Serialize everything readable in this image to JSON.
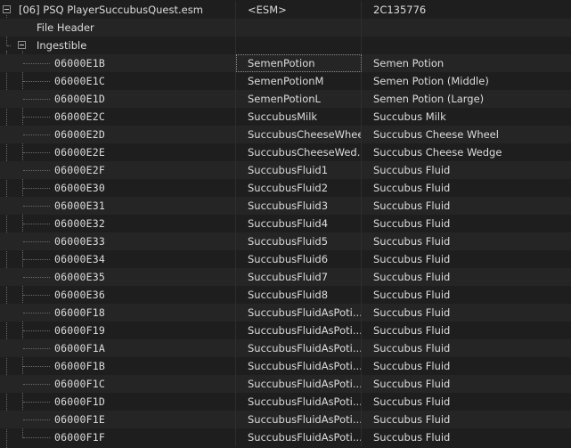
{
  "root": {
    "label": "[06] PSQ PlayerSuccubusQuest.esm",
    "edid": "<ESM>",
    "name": "2C135776"
  },
  "file_header": {
    "label": "File Header"
  },
  "group": {
    "label": "Ingestible"
  },
  "records": [
    {
      "formid": "06000E1B",
      "edid": "SemenPotion",
      "name": "Semen Potion"
    },
    {
      "formid": "06000E1C",
      "edid": "SemenPotionM",
      "name": "Semen Potion (Middle)"
    },
    {
      "formid": "06000E1D",
      "edid": "SemenPotionL",
      "name": "Semen Potion (Large)"
    },
    {
      "formid": "06000E2C",
      "edid": "SuccubusMilk",
      "name": "Succubus Milk"
    },
    {
      "formid": "06000E2D",
      "edid": "SuccubusCheeseWheel",
      "name": "Succubus Cheese Wheel"
    },
    {
      "formid": "06000E2E",
      "edid": "SuccubusCheeseWed...",
      "name": "Succubus Cheese Wedge"
    },
    {
      "formid": "06000E2F",
      "edid": "SuccubusFluid1",
      "name": "Succubus Fluid"
    },
    {
      "formid": "06000E30",
      "edid": "SuccubusFluid2",
      "name": "Succubus Fluid"
    },
    {
      "formid": "06000E31",
      "edid": "SuccubusFluid3",
      "name": "Succubus Fluid"
    },
    {
      "formid": "06000E32",
      "edid": "SuccubusFluid4",
      "name": "Succubus Fluid"
    },
    {
      "formid": "06000E33",
      "edid": "SuccubusFluid5",
      "name": "Succubus Fluid"
    },
    {
      "formid": "06000E34",
      "edid": "SuccubusFluid6",
      "name": "Succubus Fluid"
    },
    {
      "formid": "06000E35",
      "edid": "SuccubusFluid7",
      "name": "Succubus Fluid"
    },
    {
      "formid": "06000E36",
      "edid": "SuccubusFluid8",
      "name": "Succubus Fluid"
    },
    {
      "formid": "06000F18",
      "edid": "SuccubusFluidAsPoti...",
      "name": "Succubus Fluid"
    },
    {
      "formid": "06000F19",
      "edid": "SuccubusFluidAsPoti...",
      "name": "Succubus Fluid"
    },
    {
      "formid": "06000F1A",
      "edid": "SuccubusFluidAsPoti...",
      "name": "Succubus Fluid"
    },
    {
      "formid": "06000F1B",
      "edid": "SuccubusFluidAsPoti...",
      "name": "Succubus Fluid"
    },
    {
      "formid": "06000F1C",
      "edid": "SuccubusFluidAsPoti...",
      "name": "Succubus Fluid"
    },
    {
      "formid": "06000F1D",
      "edid": "SuccubusFluidAsPoti...",
      "name": "Succubus Fluid"
    },
    {
      "formid": "06000F1E",
      "edid": "SuccubusFluidAsPoti...",
      "name": "Succubus Fluid"
    },
    {
      "formid": "06000F1F",
      "edid": "SuccubusFluidAsPoti...",
      "name": "Succubus Fluid"
    }
  ]
}
